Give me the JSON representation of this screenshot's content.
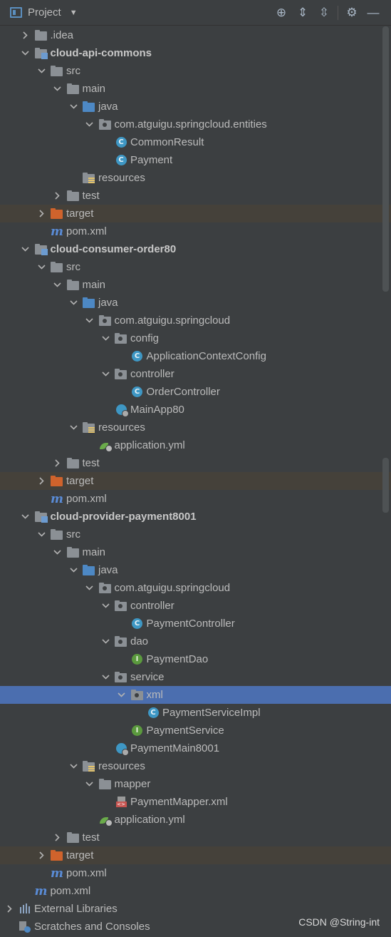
{
  "toolbar": {
    "title": "Project",
    "actions": [
      {
        "name": "locate-icon",
        "glyph": "⊕"
      },
      {
        "name": "expand-all-icon",
        "glyph": "⇕"
      },
      {
        "name": "collapse-all-icon",
        "glyph": "⇳"
      },
      {
        "name": "settings-icon",
        "glyph": "⚙"
      },
      {
        "name": "hide-icon",
        "glyph": "—"
      }
    ]
  },
  "tree": [
    {
      "depth": 1,
      "arrow": "collapsed",
      "icon": "folder",
      "label": ".idea"
    },
    {
      "depth": 1,
      "arrow": "expanded",
      "icon": "module",
      "label": "cloud-api-commons",
      "bold": true
    },
    {
      "depth": 2,
      "arrow": "expanded",
      "icon": "folder",
      "label": "src"
    },
    {
      "depth": 3,
      "arrow": "expanded",
      "icon": "folder",
      "label": "main"
    },
    {
      "depth": 4,
      "arrow": "expanded",
      "icon": "folder-blue",
      "label": "java"
    },
    {
      "depth": 5,
      "arrow": "expanded",
      "icon": "package",
      "label": "com.atguigu.springcloud.entities"
    },
    {
      "depth": 6,
      "arrow": "none",
      "icon": "class",
      "label": "CommonResult"
    },
    {
      "depth": 6,
      "arrow": "none",
      "icon": "class",
      "label": "Payment"
    },
    {
      "depth": 4,
      "arrow": "none",
      "icon": "resources",
      "label": "resources"
    },
    {
      "depth": 3,
      "arrow": "collapsed",
      "icon": "folder",
      "label": "test"
    },
    {
      "depth": 2,
      "arrow": "collapsed",
      "icon": "folder-orange",
      "label": "target",
      "style": "target"
    },
    {
      "depth": 2,
      "arrow": "none",
      "icon": "maven",
      "label": "pom.xml"
    },
    {
      "depth": 1,
      "arrow": "expanded",
      "icon": "module",
      "label": "cloud-consumer-order80",
      "bold": true
    },
    {
      "depth": 2,
      "arrow": "expanded",
      "icon": "folder",
      "label": "src"
    },
    {
      "depth": 3,
      "arrow": "expanded",
      "icon": "folder",
      "label": "main"
    },
    {
      "depth": 4,
      "arrow": "expanded",
      "icon": "folder-blue",
      "label": "java"
    },
    {
      "depth": 5,
      "arrow": "expanded",
      "icon": "package",
      "label": "com.atguigu.springcloud"
    },
    {
      "depth": 6,
      "arrow": "expanded",
      "icon": "package",
      "label": "config"
    },
    {
      "depth": 7,
      "arrow": "none",
      "icon": "class",
      "label": "ApplicationContextConfig"
    },
    {
      "depth": 6,
      "arrow": "expanded",
      "icon": "package",
      "label": "controller"
    },
    {
      "depth": 7,
      "arrow": "none",
      "icon": "class",
      "label": "OrderController"
    },
    {
      "depth": 6,
      "arrow": "none",
      "icon": "boot",
      "label": "MainApp80"
    },
    {
      "depth": 4,
      "arrow": "expanded",
      "icon": "resources",
      "label": "resources"
    },
    {
      "depth": 5,
      "arrow": "none",
      "icon": "yml",
      "label": "application.yml"
    },
    {
      "depth": 3,
      "arrow": "collapsed",
      "icon": "folder",
      "label": "test"
    },
    {
      "depth": 2,
      "arrow": "collapsed",
      "icon": "folder-orange",
      "label": "target",
      "style": "target"
    },
    {
      "depth": 2,
      "arrow": "none",
      "icon": "maven",
      "label": "pom.xml"
    },
    {
      "depth": 1,
      "arrow": "expanded",
      "icon": "module",
      "label": "cloud-provider-payment8001",
      "bold": true
    },
    {
      "depth": 2,
      "arrow": "expanded",
      "icon": "folder",
      "label": "src"
    },
    {
      "depth": 3,
      "arrow": "expanded",
      "icon": "folder",
      "label": "main"
    },
    {
      "depth": 4,
      "arrow": "expanded",
      "icon": "folder-blue",
      "label": "java"
    },
    {
      "depth": 5,
      "arrow": "expanded",
      "icon": "package",
      "label": "com.atguigu.springcloud"
    },
    {
      "depth": 6,
      "arrow": "expanded",
      "icon": "package",
      "label": "controller"
    },
    {
      "depth": 7,
      "arrow": "none",
      "icon": "class",
      "label": "PaymentController"
    },
    {
      "depth": 6,
      "arrow": "expanded",
      "icon": "package",
      "label": "dao"
    },
    {
      "depth": 7,
      "arrow": "none",
      "icon": "interface",
      "label": "PaymentDao"
    },
    {
      "depth": 6,
      "arrow": "expanded",
      "icon": "package",
      "label": "service"
    },
    {
      "depth": 7,
      "arrow": "expanded",
      "icon": "package",
      "label": "xml",
      "style": "selected"
    },
    {
      "depth": 8,
      "arrow": "none",
      "icon": "class",
      "label": "PaymentServiceImpl"
    },
    {
      "depth": 7,
      "arrow": "none",
      "icon": "interface",
      "label": "PaymentService"
    },
    {
      "depth": 6,
      "arrow": "none",
      "icon": "boot",
      "label": "PaymentMain8001"
    },
    {
      "depth": 4,
      "arrow": "expanded",
      "icon": "resources",
      "label": "resources"
    },
    {
      "depth": 5,
      "arrow": "expanded",
      "icon": "folder",
      "label": "mapper"
    },
    {
      "depth": 6,
      "arrow": "none",
      "icon": "xml",
      "label": "PaymentMapper.xml"
    },
    {
      "depth": 5,
      "arrow": "none",
      "icon": "yml",
      "label": "application.yml"
    },
    {
      "depth": 3,
      "arrow": "collapsed",
      "icon": "folder",
      "label": "test"
    },
    {
      "depth": 2,
      "arrow": "collapsed",
      "icon": "folder-orange",
      "label": "target",
      "style": "target"
    },
    {
      "depth": 2,
      "arrow": "none",
      "icon": "maven",
      "label": "pom.xml"
    },
    {
      "depth": 1,
      "arrow": "none",
      "icon": "maven",
      "label": "pom.xml"
    },
    {
      "depth": 0,
      "arrow": "collapsed",
      "icon": "ext-libs",
      "label": "External Libraries"
    },
    {
      "depth": 0,
      "arrow": "none",
      "icon": "scratches",
      "label": "Scratches and Consoles"
    }
  ],
  "watermark": "CSDN @String-int"
}
